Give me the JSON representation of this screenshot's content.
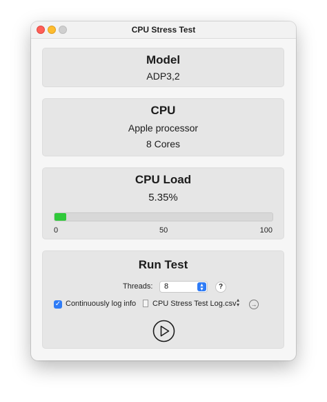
{
  "window": {
    "title": "CPU Stress Test"
  },
  "model": {
    "heading": "Model",
    "value": "ADP3,2"
  },
  "cpu": {
    "heading": "CPU",
    "processor": "Apple processor",
    "cores": "8 Cores"
  },
  "cpu_load": {
    "heading": "CPU Load",
    "value_text": "5.35%",
    "progress_percent": 5.35,
    "scale": {
      "min": "0",
      "mid": "50",
      "max": "100"
    },
    "bar_color": "#30c93a"
  },
  "run_test": {
    "heading": "Run Test",
    "threads_label": "Threads:",
    "threads_value": "8",
    "help_label": "?",
    "log_checkbox_label": "Continuously log info",
    "log_checked": true,
    "log_file_name": "CPU Stress Test Log.csv",
    "icons": {
      "file": "document-icon",
      "chooser": "chevron-up-down-icon",
      "reveal": "arrow-circle-right-icon",
      "start": "play-circle-icon"
    }
  },
  "colors": {
    "accent": "#2f7cf6",
    "close": "#fe5f57",
    "minimize": "#febc2e",
    "zoom_disabled": "#cfcfcf"
  }
}
